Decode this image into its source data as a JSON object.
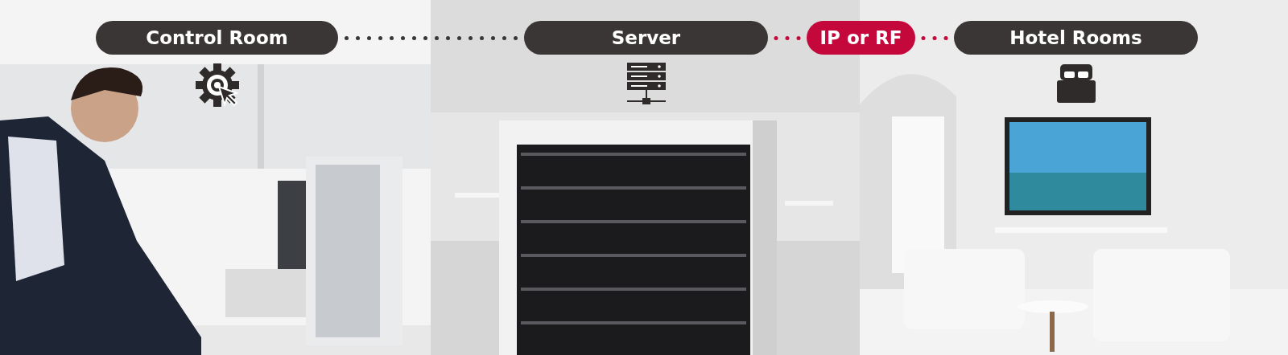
{
  "stages": [
    {
      "kind": "control",
      "label": "Control Room"
    },
    {
      "kind": "server",
      "label": "Server"
    },
    {
      "kind": "link",
      "label": "IP or RF"
    },
    {
      "kind": "rooms",
      "label": "Hotel Rooms"
    }
  ]
}
